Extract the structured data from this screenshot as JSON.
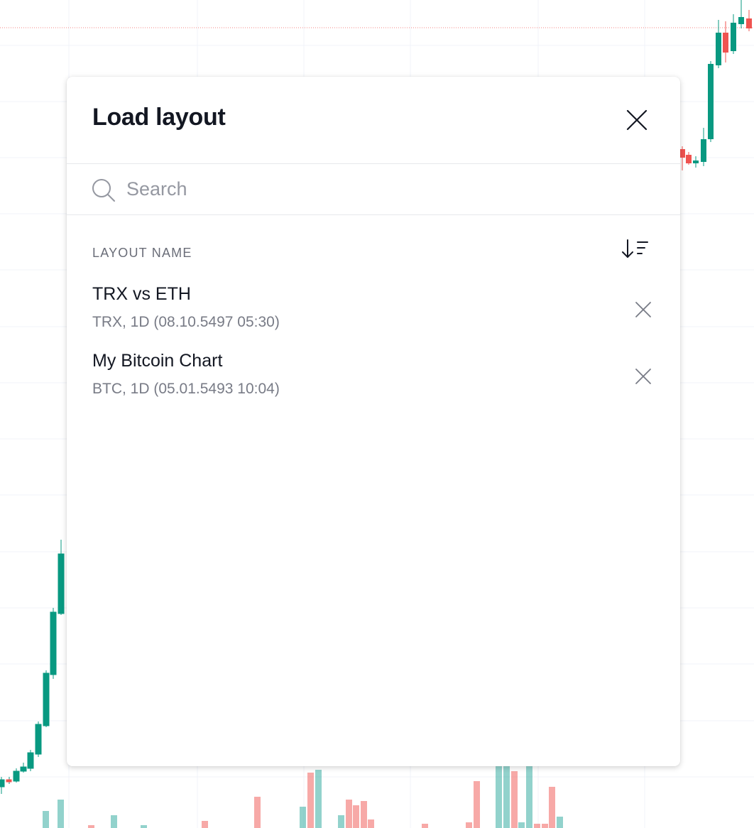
{
  "dialog": {
    "title": "Load layout",
    "close_icon": "close-icon",
    "search": {
      "placeholder": "Search",
      "value": "",
      "icon": "search-icon"
    },
    "list_header": "LAYOUT NAME",
    "sort_icon": "sort-descending-icon",
    "layouts": [
      {
        "name": "TRX vs ETH",
        "meta": "TRX, 1D (08.10.5497 05:30)",
        "remove_icon": "close-icon"
      },
      {
        "name": "My Bitcoin Chart",
        "meta": "BTC, 1D (05.01.5493 10:04)",
        "remove_icon": "close-icon"
      }
    ]
  },
  "colors": {
    "up": "#26a69a",
    "down": "#ef5350",
    "grid": "#f0f3fa",
    "title": "#131722",
    "muted": "#787b86"
  }
}
